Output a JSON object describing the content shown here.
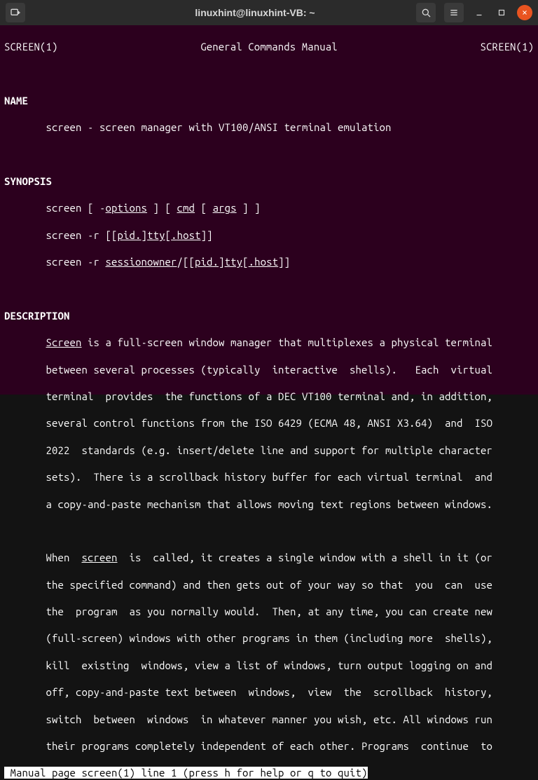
{
  "titlebar": {
    "title": "linuxhint@linuxhint-VB: ~"
  },
  "header": {
    "left": "SCREEN(1)",
    "center": "General Commands Manual",
    "right": "SCREEN(1)"
  },
  "sections": {
    "name_heading": "NAME",
    "name_body": "       screen - screen manager with VT100/ANSI terminal emulation",
    "synopsis_heading": "SYNOPSIS",
    "syn1_pre": "       screen [ -",
    "syn1_options": "options",
    "syn1_mid": " ] [ ",
    "syn1_cmd": "cmd",
    "syn1_mid2": " [ ",
    "syn1_args": "args",
    "syn1_end": " ] ]",
    "syn2_pre": "       screen -r [[",
    "syn2_pid": "pid",
    "syn2_dot": ".",
    "syn2_tty": "tty",
    "syn2_mid": "[.",
    "syn2_host": "host",
    "syn2_end": "]]",
    "syn3_pre": "       screen -r ",
    "syn3_sessionowner": "sessionowner",
    "syn3_slash": "/[[",
    "syn3_pid": "pid",
    "syn3_dot": ".",
    "syn3_tty": "tty",
    "syn3_mid": "[.",
    "syn3_host": "host",
    "syn3_end": "]]",
    "description_heading": "DESCRIPTION",
    "desc_indent": "       ",
    "desc_screen": "Screen",
    "desc_p1_l1b": " is a full-screen window manager that multiplexes a physical terminal",
    "desc_p1_l2": "       between several processes (typically  interactive  shells).   Each  virtual",
    "desc_p1_l3": "       terminal  provides  the functions of a DEC VT100 terminal and, in addition,",
    "desc_p1_l4": "       several control functions from the ISO 6429 (ECMA 48, ANSI X3.64)  and  ISO",
    "desc_p1_l5": "       2022  standards (e.g. insert/delete line and support for multiple character",
    "desc_p1_l6": "       sets).  There is a scrollback history buffer for each virtual terminal  and",
    "desc_p1_l7": "       a copy-and-paste mechanism that allows moving text regions between windows.",
    "desc_p2_l1a": "       When  ",
    "desc_p2_screen": "screen",
    "desc_p2_l1b": "  is  called, it creates a single window with a shell in it (or",
    "desc_p2_l2": "       the specified command) and then gets out of your way so that  you  can  use",
    "desc_p2_l3": "       the  program  as you normally would.  Then, at any time, you can create new",
    "desc_p2_l4": "       (full-screen) windows with other programs in them (including more  shells),",
    "desc_p2_l5": "       kill  existing  windows, view a list of windows, turn output logging on and",
    "desc_p2_l6": "       off, copy-and-paste text between  windows,  view  the  scrollback  history,",
    "desc_p2_l7": "       switch  between  windows  in whatever manner you wish, etc. All windows run",
    "desc_p2_l8": "       their programs completely independent of each other. Programs  continue  to"
  },
  "statusbar": " Manual page screen(1) line 1 (press h for help or q to quit)"
}
